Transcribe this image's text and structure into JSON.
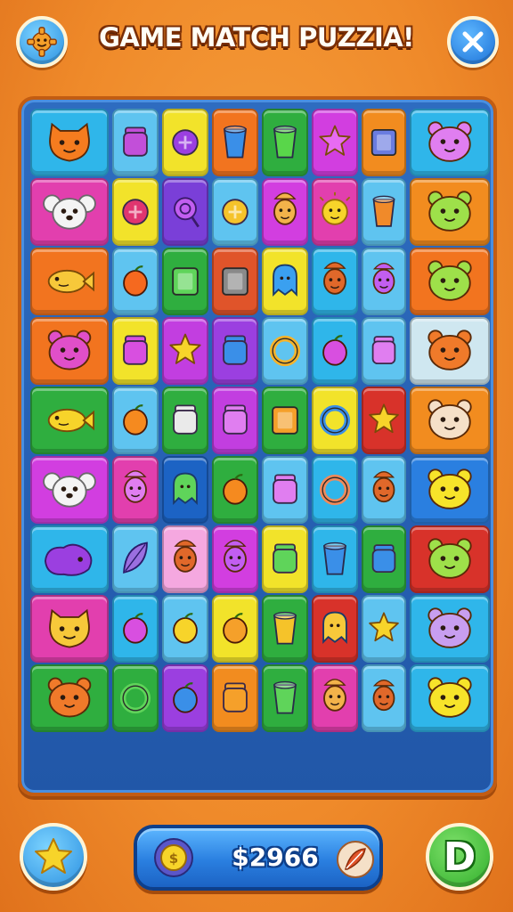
{
  "header": {
    "title": "GAME MATCH PUZZIA!",
    "settings_icon": "gear-icon",
    "close_icon": "close-icon"
  },
  "board": {
    "rows": [
      [
        {
          "bg": "#2fb6ea",
          "icon": "cat-face",
          "color": "#f57c1f"
        },
        {
          "bg": "#5fc4f0",
          "icon": "jar",
          "color": "#c24fd9"
        },
        {
          "bg": "#f2e32a",
          "icon": "round-candy",
          "color": "#9b3fe0"
        },
        {
          "bg": "#f2741f",
          "icon": "cup",
          "color": "#3a8fe8"
        },
        {
          "bg": "#2fae3f",
          "icon": "cup",
          "color": "#59d64a"
        },
        {
          "bg": "#d23ee0",
          "icon": "star-blob",
          "color": "#e86bf2"
        },
        {
          "bg": "#f28c1f",
          "icon": "square-tile",
          "color": "#6a7ce0"
        },
        {
          "bg": "#2fb6ea",
          "icon": "bear-face",
          "color": "#e07ef0"
        }
      ],
      [
        {
          "bg": "#e23fae",
          "icon": "koala-face",
          "color": "#f4f4f4"
        },
        {
          "bg": "#f2e32a",
          "icon": "round-candy",
          "color": "#e0356f"
        },
        {
          "bg": "#7a3fd8",
          "icon": "lollipop",
          "color": "#c25ef0"
        },
        {
          "bg": "#5fc4f0",
          "icon": "round-candy",
          "color": "#f5c32a"
        },
        {
          "bg": "#d23ee0",
          "icon": "person-face",
          "color": "#f2b24a"
        },
        {
          "bg": "#e23fae",
          "icon": "sun-face",
          "color": "#f7d42a"
        },
        {
          "bg": "#5fc4f0",
          "icon": "cup",
          "color": "#f08a2a"
        },
        {
          "bg": "#f28c1f",
          "icon": "bear-face",
          "color": "#9ee04a"
        }
      ],
      [
        {
          "bg": "#f2741f",
          "icon": "fish",
          "color": "#f7c83a"
        },
        {
          "bg": "#5fc4f0",
          "icon": "fruit",
          "color": "#f5691f"
        },
        {
          "bg": "#2fae3f",
          "icon": "square-tile",
          "color": "#5fd45a"
        },
        {
          "bg": "#e0542a",
          "icon": "square-tile",
          "color": "#8a8a8a"
        },
        {
          "bg": "#f2e32a",
          "icon": "ghost",
          "color": "#3aa0f0"
        },
        {
          "bg": "#2fb6ea",
          "icon": "person-face",
          "color": "#e0682a"
        },
        {
          "bg": "#5fc4f0",
          "icon": "person-face",
          "color": "#c25ef0"
        },
        {
          "bg": "#f2741f",
          "icon": "bear-face",
          "color": "#9ee04a"
        }
      ],
      [
        {
          "bg": "#f2741f",
          "icon": "bear-face",
          "color": "#e04fc9"
        },
        {
          "bg": "#f2e32a",
          "icon": "jar",
          "color": "#d84fe0"
        },
        {
          "bg": "#c23ee0",
          "icon": "star-blob",
          "color": "#f7d42a"
        },
        {
          "bg": "#9b3fe0",
          "icon": "jar",
          "color": "#3a8fe8"
        },
        {
          "bg": "#5fc4f0",
          "icon": "ring",
          "color": "#f5b32a"
        },
        {
          "bg": "#2fb6ea",
          "icon": "fruit",
          "color": "#d84fe0"
        },
        {
          "bg": "#5fc4f0",
          "icon": "jar",
          "color": "#e07ef0"
        },
        {
          "bg": "#cfe7f0",
          "icon": "bear-face",
          "color": "#f07a2a"
        }
      ],
      [
        {
          "bg": "#2fae3f",
          "icon": "fish",
          "color": "#f7d42a"
        },
        {
          "bg": "#5fc4f0",
          "icon": "fruit",
          "color": "#f58a1f"
        },
        {
          "bg": "#2fae3f",
          "icon": "jar",
          "color": "#eaeaea"
        },
        {
          "bg": "#c23ee0",
          "icon": "jar",
          "color": "#e07ef0"
        },
        {
          "bg": "#2fae3f",
          "icon": "square-tile",
          "color": "#f5a02a"
        },
        {
          "bg": "#f2e32a",
          "icon": "ring",
          "color": "#3a8fe8"
        },
        {
          "bg": "#d8322a",
          "icon": "star-blob",
          "color": "#f7d42a"
        },
        {
          "bg": "#f28c1f",
          "icon": "bear-face",
          "color": "#f5e0c8"
        }
      ],
      [
        {
          "bg": "#d23ee0",
          "icon": "koala-face",
          "color": "#f4f4f4"
        },
        {
          "bg": "#e23fae",
          "icon": "person-face",
          "color": "#e07ef0"
        },
        {
          "bg": "#1c63c4",
          "icon": "ghost",
          "color": "#5fd45a"
        },
        {
          "bg": "#2fae3f",
          "icon": "fruit",
          "color": "#f58a1f"
        },
        {
          "bg": "#5fc4f0",
          "icon": "jar",
          "color": "#e07ef0"
        },
        {
          "bg": "#2fb6ea",
          "icon": "ring",
          "color": "#f08a5a"
        },
        {
          "bg": "#5fc4f0",
          "icon": "person-face",
          "color": "#e0682a"
        },
        {
          "bg": "#2a7fe0",
          "icon": "bear-face",
          "color": "#f7e42a"
        }
      ],
      [
        {
          "bg": "#2fb6ea",
          "icon": "blob",
          "color": "#9b3fe0"
        },
        {
          "bg": "#5fc4f0",
          "icon": "leaf",
          "color": "#9b6fe0"
        },
        {
          "bg": "#f5a8e0",
          "icon": "person-face",
          "color": "#e0682a"
        },
        {
          "bg": "#d23ee0",
          "icon": "person-face",
          "color": "#c25ef0"
        },
        {
          "bg": "#f2e32a",
          "icon": "jar",
          "color": "#5fd45a"
        },
        {
          "bg": "#2fb6ea",
          "icon": "cup",
          "color": "#3a8fe8"
        },
        {
          "bg": "#2fae3f",
          "icon": "jar",
          "color": "#3a8fe8"
        },
        {
          "bg": "#d8322a",
          "icon": "bear-face",
          "color": "#9ee04a"
        }
      ],
      [
        {
          "bg": "#e23fae",
          "icon": "cat-face",
          "color": "#f7c83a"
        },
        {
          "bg": "#2fb6ea",
          "icon": "fruit",
          "color": "#d84fe0"
        },
        {
          "bg": "#5fc4f0",
          "icon": "fruit",
          "color": "#f7d42a"
        },
        {
          "bg": "#f2e32a",
          "icon": "fruit",
          "color": "#f5a02a"
        },
        {
          "bg": "#2fae3f",
          "icon": "cup",
          "color": "#f5c32a"
        },
        {
          "bg": "#d8322a",
          "icon": "ghost",
          "color": "#f7c83a"
        },
        {
          "bg": "#5fc4f0",
          "icon": "star-blob",
          "color": "#f7d42a"
        },
        {
          "bg": "#2fb6ea",
          "icon": "bear-face",
          "color": "#c89ef0"
        }
      ],
      [
        {
          "bg": "#2fae3f",
          "icon": "bear-face",
          "color": "#f07a2a"
        },
        {
          "bg": "#2fae3f",
          "icon": "ring",
          "color": "#5fd45a"
        },
        {
          "bg": "#9b3fe0",
          "icon": "fruit",
          "color": "#3a8fe8"
        },
        {
          "bg": "#f28c1f",
          "icon": "jar",
          "color": "#f5a02a"
        },
        {
          "bg": "#2fae3f",
          "icon": "cup",
          "color": "#5fd45a"
        },
        {
          "bg": "#e23fae",
          "icon": "person-face",
          "color": "#f2b24a"
        },
        {
          "bg": "#5fc4f0",
          "icon": "person-face",
          "color": "#e0682a"
        },
        {
          "bg": "#2fb6ea",
          "icon": "bear-face",
          "color": "#f7e42a"
        }
      ]
    ]
  },
  "footer": {
    "star_icon": "star-icon",
    "coins": "$2966",
    "coin_icon": "coin-icon",
    "shield_icon": "feather-icon",
    "d_label": "D"
  }
}
